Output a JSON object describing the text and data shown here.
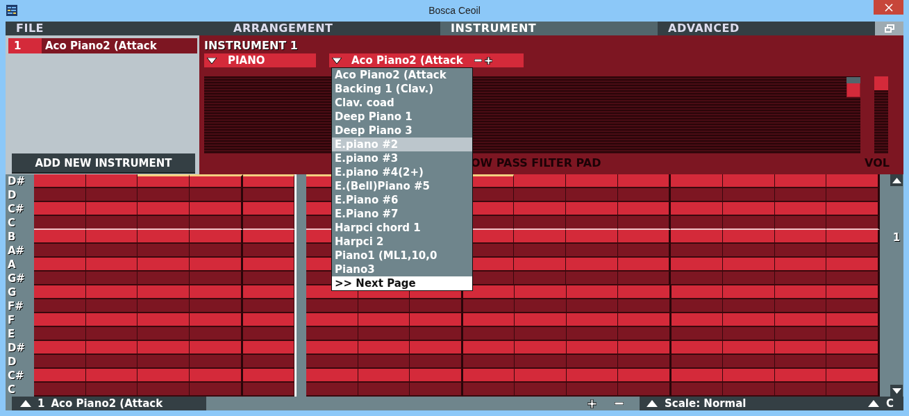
{
  "window": {
    "title": "Bosca Ceoil"
  },
  "menu_tabs": [
    {
      "label": "FILE",
      "selected": false
    },
    {
      "label": "ARRANGEMENT",
      "selected": false
    },
    {
      "label": "INSTRUMENT",
      "selected": true
    },
    {
      "label": "ADVANCED",
      "selected": false
    }
  ],
  "instrument_list": [
    {
      "number": "1",
      "name": "Aco Piano2 (Attack",
      "selected": true
    }
  ],
  "add_button": "ADD NEW INSTRUMENT",
  "instrument_panel": {
    "heading": "INSTRUMENT 1",
    "category": "PIANO",
    "preset": "Aco Piano2 (Attack",
    "filter_label": "OW PASS FILTER PAD",
    "volume_label": "VOL",
    "filter_pad": {
      "level": 1
    },
    "volume": {
      "level": 1
    }
  },
  "preset_menu": {
    "items": [
      {
        "label": "Aco Piano2 (Attack",
        "selected": false
      },
      {
        "label": "Backing 1 (Clav.)",
        "selected": false
      },
      {
        "label": "Clav. coad",
        "selected": false
      },
      {
        "label": "Deep Piano 1",
        "selected": false
      },
      {
        "label": "Deep Piano 3",
        "selected": false
      },
      {
        "label": "E.piano #2",
        "selected": true
      },
      {
        "label": "E.piano #3",
        "selected": false
      },
      {
        "label": "E.piano #4(2+)",
        "selected": false
      },
      {
        "label": "E.(Bell)Piano #5",
        "selected": false
      },
      {
        "label": "E.Piano #6",
        "selected": false
      },
      {
        "label": "E.Piano #7",
        "selected": false
      },
      {
        "label": "Harpci chord 1",
        "selected": false
      },
      {
        "label": "Harpci 2",
        "selected": false
      },
      {
        "label": "Piano1 (ML1,10,0",
        "selected": false
      },
      {
        "label": "Piano3",
        "selected": false
      }
    ],
    "next_page": ">> Next Page"
  },
  "piano_roll": {
    "notes": [
      "D#",
      "D",
      "C#",
      "C",
      "B",
      "A#",
      "A",
      "G#",
      "G",
      "F#",
      "F",
      "E",
      "D#",
      "D",
      "C#",
      "C"
    ],
    "columns": [
      {
        "highlighted": false
      },
      {
        "highlighted": false
      },
      {
        "highlighted": true
      },
      {
        "highlighted": true
      },
      {
        "highlighted": true
      },
      {
        "highlighted": true
      },
      {},
      {},
      {
        "highlighted": true
      },
      {
        "highlighted": false
      },
      {
        "highlighted": false
      },
      {
        "highlighted": false
      },
      {
        "highlighted": false
      },
      {
        "highlighted": false
      },
      {
        "highlighted": false
      },
      {
        "highlighted": false
      }
    ],
    "octave_label": "1"
  },
  "bottom_bar": {
    "instrument_number": "1",
    "instrument_name": "Aco Piano2 (Attack",
    "scale": "Scale: Normal",
    "key": "C"
  }
}
